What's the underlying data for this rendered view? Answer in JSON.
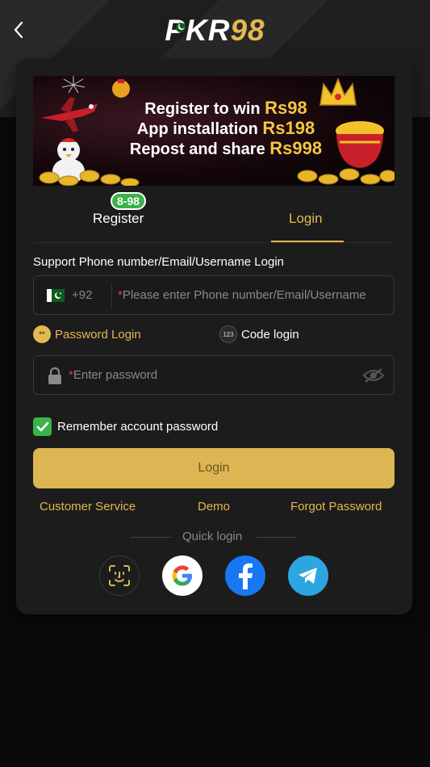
{
  "header": {
    "logo_text_a": "PKR",
    "logo_text_b": "98"
  },
  "banner": {
    "line1_text": "Register to win ",
    "line1_amount": "Rs98",
    "line2_text": "App installation ",
    "line2_amount": "Rs198",
    "line3_text": "Repost and share ",
    "line3_amount": "Rs998"
  },
  "tabs": {
    "register_label": "Register",
    "register_badge": "8-98",
    "login_label": "Login",
    "active": "login"
  },
  "form": {
    "account_label": "Support Phone number/Email/Username Login",
    "country_code": "+92",
    "required_mark": "*",
    "account_placeholder": "Please enter Phone number/Email/Username",
    "password_login_label": "Password Login",
    "password_login_icon_text": "**",
    "code_login_label": "Code login",
    "code_login_icon_text": "123",
    "password_placeholder": "Enter password",
    "remember_label": "Remember account password",
    "remember_checked": true,
    "login_button": "Login"
  },
  "links": {
    "customer_service": "Customer Service",
    "demo": "Demo",
    "forgot_password": "Forgot Password"
  },
  "quick_login": {
    "label": "Quick login",
    "providers": [
      "face-id",
      "google",
      "facebook",
      "telegram"
    ]
  },
  "colors": {
    "accent": "#e5b84f",
    "button": "#ddb553",
    "success": "#3bb34a",
    "card": "#1c1c1c",
    "background": "#0a0a0a"
  }
}
